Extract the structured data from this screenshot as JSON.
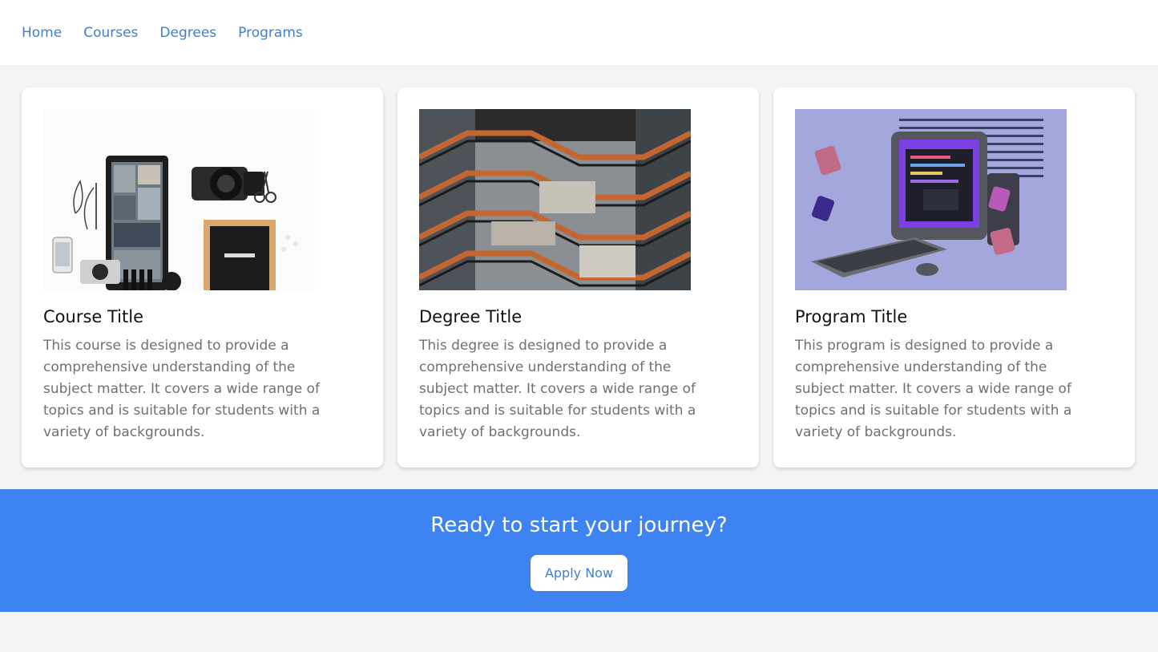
{
  "nav": {
    "items": [
      {
        "label": "Home"
      },
      {
        "label": "Courses"
      },
      {
        "label": "Degrees"
      },
      {
        "label": "Programs"
      }
    ]
  },
  "cards": [
    {
      "title": "Course Title",
      "description": "This course is designed to provide a comprehensive understanding of the subject matter. It covers a wide range of topics and is suitable for students with a variety of backgrounds.",
      "image": "workspace-flatlay-photo"
    },
    {
      "title": "Degree Title",
      "description": "This degree is designed to provide a comprehensive understanding of the subject matter. It covers a wide range of topics and is suitable for students with a variety of backgrounds.",
      "image": "vessel-staircase-photo"
    },
    {
      "title": "Program Title",
      "description": "This program is designed to provide a comprehensive understanding of the subject matter. It covers a wide range of topics and is suitable for students with a variety of backgrounds.",
      "image": "computer-code-illustration"
    }
  ],
  "cta": {
    "heading": "Ready to start your journey?",
    "button_label": "Apply Now"
  },
  "colors": {
    "accent": "#3e83f2",
    "link": "#3f7fd1",
    "page_bg": "#f3f4f6"
  }
}
